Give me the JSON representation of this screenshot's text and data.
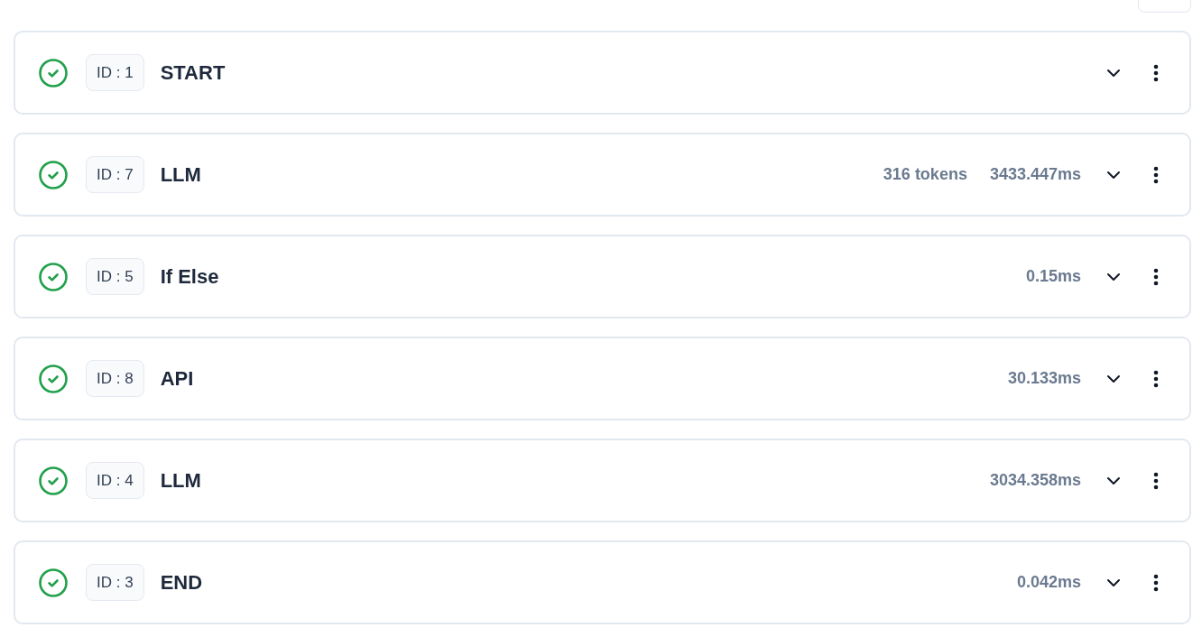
{
  "nodes": [
    {
      "succeeded": true,
      "id": "ID : 1",
      "title": "START",
      "expanded": false
    },
    {
      "succeeded": true,
      "id": "ID : 7",
      "title": "LLM",
      "metrics": [
        "316 tokens",
        "3433.447ms"
      ],
      "expanded": false
    },
    {
      "succeeded": true,
      "id": "ID : 5",
      "title": "If Else",
      "metrics": [
        "0.15ms"
      ],
      "expanded": false
    },
    {
      "succeeded": true,
      "id": "ID : 8",
      "title": "API",
      "metrics": [
        "30.133ms"
      ],
      "expanded": false
    },
    {
      "succeeded": true,
      "id": "ID : 4",
      "title": "LLM",
      "metrics": [
        "3034.358ms"
      ],
      "expanded": false
    },
    {
      "succeeded": true,
      "id": "ID : 3",
      "title": "END",
      "metrics": [
        "0.042ms"
      ],
      "expanded": false
    }
  ]
}
